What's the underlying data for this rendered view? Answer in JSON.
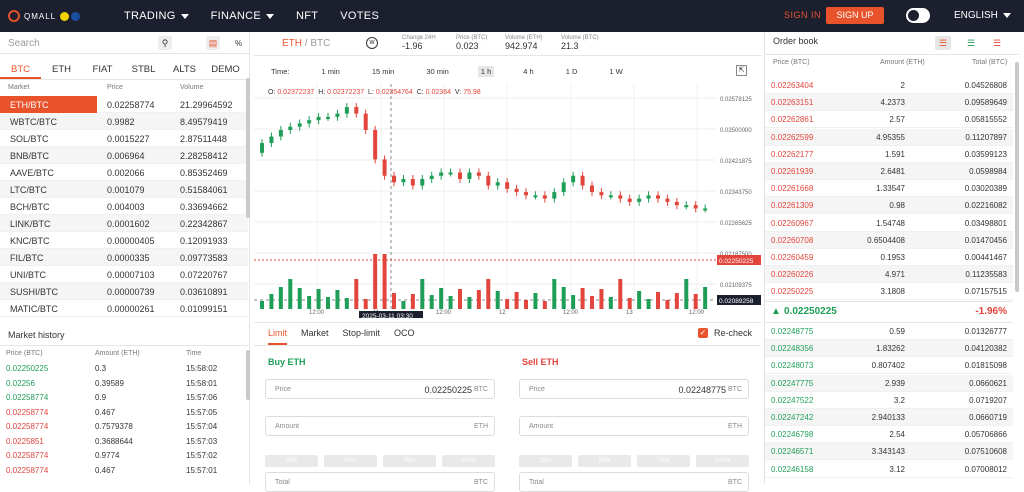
{
  "header": {
    "logo": "QMALL",
    "nav": [
      "TRADING",
      "FINANCE",
      "NFT",
      "VOTES"
    ],
    "signin": "SIGN IN",
    "signup": "SIGN UP",
    "language": "ENGLISH"
  },
  "left": {
    "search_placeholder": "Search",
    "pct_label": "%",
    "tabs": [
      "BTC",
      "ETH",
      "FIAT",
      "STBL",
      "ALTS",
      "DEMO"
    ],
    "headers": [
      "Market",
      "Price",
      "Volume"
    ],
    "markets": [
      [
        "ETH/BTC",
        "0.02258774",
        "21.29964592"
      ],
      [
        "WBTC/BTC",
        "0.9982",
        "8.49579419"
      ],
      [
        "SOL/BTC",
        "0.0015227",
        "2.87511448"
      ],
      [
        "BNB/BTC",
        "0.006964",
        "2.28258412"
      ],
      [
        "AAVE/BTC",
        "0.002066",
        "0.85352469"
      ],
      [
        "LTC/BTC",
        "0.001079",
        "0.51584061"
      ],
      [
        "BCH/BTC",
        "0.004003",
        "0.33694662"
      ],
      [
        "LINK/BTC",
        "0.0001602",
        "0.22342867"
      ],
      [
        "KNC/BTC",
        "0.00000405",
        "0.12091933"
      ],
      [
        "FIL/BTC",
        "0.0000335",
        "0.09773583"
      ],
      [
        "UNI/BTC",
        "0.00007103",
        "0.07220767"
      ],
      [
        "SUSHI/BTC",
        "0.00000739",
        "0.03610891"
      ],
      [
        "MATIC/BTC",
        "0.00000261",
        "0.01099151"
      ]
    ],
    "history_title": "Market history",
    "history_headers": [
      "Price (BTC)",
      "Amount (ETH)",
      "Time"
    ],
    "history": [
      [
        "0.02250225",
        "0.3",
        "15:58:02",
        "green"
      ],
      [
        "0.02256",
        "0.39589",
        "15:58:01",
        "green"
      ],
      [
        "0.02258774",
        "0.9",
        "15:57:06",
        "green"
      ],
      [
        "0.02258774",
        "0.467",
        "15:57:05",
        "red"
      ],
      [
        "0.02258774",
        "0.7579378",
        "15:57:04",
        "red"
      ],
      [
        "0.0225851",
        "0.3688644",
        "15:57:03",
        "red"
      ],
      [
        "0.02258774",
        "0.9774",
        "15:57:02",
        "red"
      ],
      [
        "0.02258774",
        "0.467",
        "15:57:01",
        "red"
      ]
    ]
  },
  "ticker": {
    "pair": "ETH",
    "quote": "/ BTC",
    "items": [
      [
        "Change 24H",
        "-1.96"
      ],
      [
        "Price (BTC)",
        "0.023"
      ],
      [
        "Volume (ETH)",
        "942.974"
      ],
      [
        "Volume (BTC)",
        "21.3"
      ]
    ]
  },
  "chart": {
    "timeframes": [
      "Time:",
      "1 min",
      "15 min",
      "30 min",
      "1 h",
      "4 h",
      "1 D",
      "1 W"
    ],
    "active_tf": "1 h",
    "ohlc": {
      "O": "0.02372237",
      "H": "0.02372237",
      "L": "0.02354764",
      "C": "0.02364",
      "V": "75.98"
    },
    "y_ticks": [
      "0.02578125",
      "0.02500000",
      "0.02421875",
      "0.02343750",
      "0.02265625",
      "0.02187500",
      "0.02109375"
    ],
    "x_ticks": [
      "12:00",
      "11",
      "12:00",
      "12",
      "12:00",
      "13",
      "12:00"
    ],
    "current_price": "0.02250225",
    "cursor_price": "0.02089258",
    "cursor_time": "2025-03-11   03:30"
  },
  "chart_data": {
    "type": "candlestick",
    "x": [
      "2025-03-10 12:00",
      "2025-03-11",
      "2025-03-11 12:00",
      "2025-03-12",
      "2025-03-12 12:00",
      "2025-03-13",
      "2025-03-13 12:00"
    ],
    "y_range": [
      0.0208,
      0.026
    ],
    "closes": [
      0.0245,
      0.0247,
      0.0249,
      0.025,
      0.0251,
      0.0252,
      0.0253,
      0.0253,
      0.0254,
      0.0256,
      0.0254,
      0.0249,
      0.024,
      0.0235,
      0.0233,
      0.0234,
      0.0232,
      0.0234,
      0.0235,
      0.0236,
      0.0236,
      0.0234,
      0.0236,
      0.0235,
      0.0232,
      0.0233,
      0.0231,
      0.023,
      0.0229,
      0.0229,
      0.0228,
      0.023,
      0.0233,
      0.0235,
      0.0232,
      0.023,
      0.0229,
      0.0229,
      0.0228,
      0.0227,
      0.0228,
      0.0229,
      0.0228,
      0.0227,
      0.0226,
      0.0226,
      0.0225,
      0.0225
    ]
  },
  "order": {
    "tabs": [
      "Limit",
      "Market",
      "Stop-limit",
      "OCO"
    ],
    "recheck": "Re-check",
    "buy_title": "Buy ETH",
    "sell_title": "Sell ETH",
    "buy_price": "0.02250225",
    "sell_price": "0.02248775",
    "price_label": "Price",
    "amount_label": "Amount",
    "total_label": "Total",
    "unit_btc": "BTC",
    "unit_eth": "ETH",
    "pcts": [
      "25%",
      "50%",
      "75%",
      "100%"
    ]
  },
  "orderbook": {
    "title": "Order book",
    "headers": [
      "Price (BTC)",
      "Amount (ETH)",
      "Total (BTC)"
    ],
    "asks": [
      [
        "0.02263404",
        "2",
        "0.04526808"
      ],
      [
        "0.02263151",
        "4.2373",
        "0.09589649"
      ],
      [
        "0.02262861",
        "2.57",
        "0.05815552"
      ],
      [
        "0.02262599",
        "4.95355",
        "0.11207897"
      ],
      [
        "0.02262177",
        "1.591",
        "0.03599123"
      ],
      [
        "0.02261939",
        "2.6481",
        "0.0598984"
      ],
      [
        "0.02261668",
        "1.33547",
        "0.03020389"
      ],
      [
        "0.02261309",
        "0.98",
        "0.02216082"
      ],
      [
        "0.02260967",
        "1.54748",
        "0.03498801"
      ],
      [
        "0.02260708",
        "0.6504408",
        "0.01470456"
      ],
      [
        "0.02260459",
        "0.1953",
        "0.00441467"
      ],
      [
        "0.02260226",
        "4.971",
        "0.11235583"
      ],
      [
        "0.02250225",
        "3.1808",
        "0.07157515"
      ]
    ],
    "mid_price": "0.02250225",
    "mid_change": "-1.96%",
    "bids": [
      [
        "0.02248775",
        "0.59",
        "0.01326777"
      ],
      [
        "0.02248356",
        "1.83262",
        "0.04120382"
      ],
      [
        "0.02248073",
        "0.807402",
        "0.01815098"
      ],
      [
        "0.02247775",
        "2.939",
        "0.0660621"
      ],
      [
        "0.02247522",
        "3.2",
        "0.0719207"
      ],
      [
        "0.02247242",
        "2.940133",
        "0.0660719"
      ],
      [
        "0.02246798",
        "2.54",
        "0.05706866"
      ],
      [
        "0.02246571",
        "3.343143",
        "0.07510608"
      ],
      [
        "0.02246158",
        "3.12",
        "0.07008012"
      ]
    ]
  }
}
